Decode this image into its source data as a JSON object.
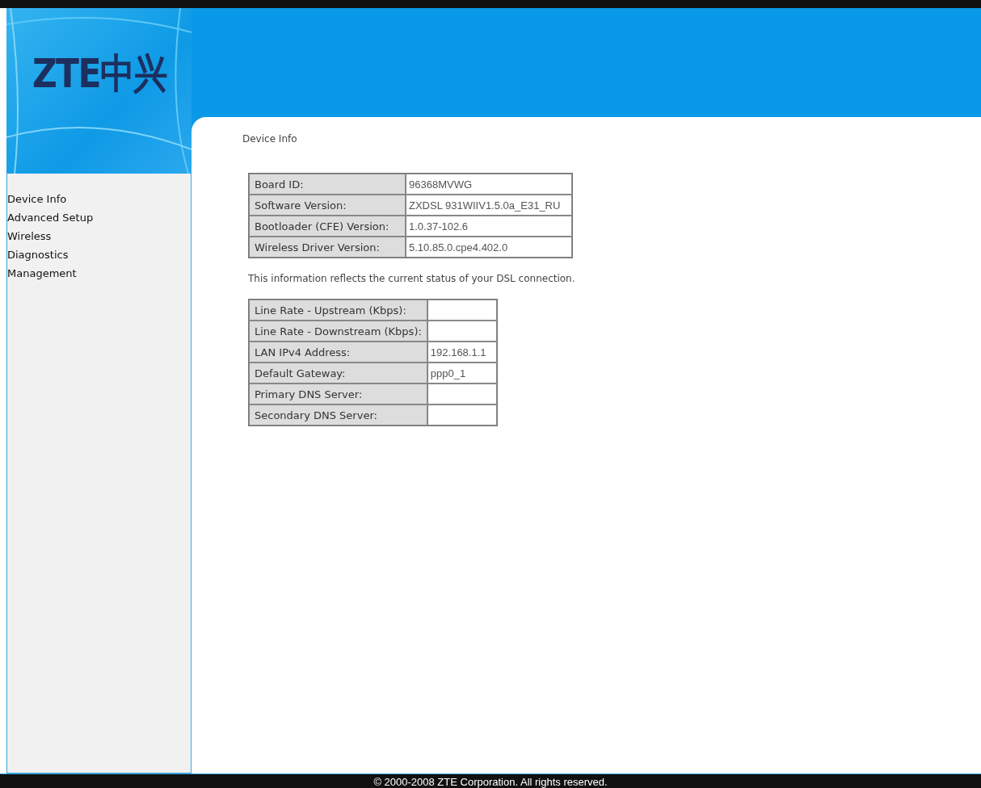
{
  "logo": {
    "text": "ZTE中兴"
  },
  "sidebar": {
    "items": [
      {
        "label": "Device Info"
      },
      {
        "label": "Advanced Setup"
      },
      {
        "label": "Wireless"
      },
      {
        "label": "Diagnostics"
      },
      {
        "label": "Management"
      }
    ]
  },
  "page_title": "Device Info",
  "device_table": {
    "rows": [
      {
        "label": "Board ID:",
        "value": "96368MVWG"
      },
      {
        "label": "Software Version:",
        "value": "ZXDSL 931WIIV1.5.0a_E31_RU"
      },
      {
        "label": "Bootloader (CFE) Version:",
        "value": "1.0.37-102.6"
      },
      {
        "label": "Wireless Driver Version:",
        "value": "5.10.85.0.cpe4.402.0"
      }
    ]
  },
  "status_note": "This information reflects the current status of your DSL connection.",
  "status_table": {
    "rows": [
      {
        "label": "Line Rate - Upstream (Kbps):"
      },
      {
        "label": "Line Rate - Downstream (Kbps):"
      },
      {
        "label": "LAN IPv4 Address:",
        "value": "192.168.1.1"
      },
      {
        "label": "Default Gateway:",
        "value": "ppp0_1"
      },
      {
        "label": "Primary DNS Server:"
      },
      {
        "label": "Secondary DNS Server:"
      }
    ]
  },
  "footer": "© 2000-2008 ZTE Corporation. All rights reserved."
}
